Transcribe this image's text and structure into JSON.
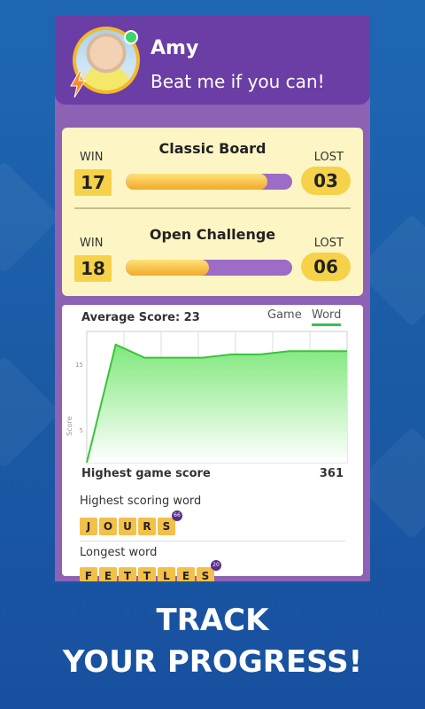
{
  "player": {
    "name": "Amy",
    "tagline": "Beat me if you can!"
  },
  "stats": [
    {
      "mode": "Classic Board",
      "win_label": "WIN",
      "win": "17",
      "lost_label": "LOST",
      "lost": "03",
      "win_fraction": 0.85
    },
    {
      "mode": "Open Challenge",
      "win_label": "WIN",
      "win": "18",
      "lost_label": "LOST",
      "lost": "06",
      "win_fraction": 0.5
    }
  ],
  "score_card": {
    "average_label": "Average Score: 23",
    "tabs": {
      "game": "Game",
      "word": "Word",
      "active": "Word"
    },
    "y_axis_label": "Score",
    "highest_game_label": "Highest game score",
    "highest_game_value": "361",
    "highest_word_label": "Highest scoring word",
    "highest_word_letters": [
      "J",
      "O",
      "U",
      "R",
      "S"
    ],
    "highest_word_score": "66",
    "longest_word_label": "Longest word",
    "longest_word_letters": [
      "F",
      "E",
      "T",
      "T",
      "L",
      "E",
      "S"
    ],
    "longest_word_score": "20"
  },
  "chart_data": {
    "type": "area",
    "y_ticks": [
      "15",
      "5"
    ],
    "ylim": [
      0,
      20
    ],
    "values": [
      0,
      18,
      16,
      16,
      16,
      16.5,
      16.5,
      17,
      17,
      17
    ],
    "grid": true,
    "fill_color": "#8ef08a",
    "line_color": "#38c43a"
  },
  "promo": {
    "line1": "TRACK",
    "line2": "YOUR PROGRESS!"
  },
  "colors": {
    "background": "#1a5aa5",
    "header": "#6b3ea5",
    "panel": "#8d61b3",
    "stats_card": "#fdf6c4",
    "tile": "#f3c04a",
    "accent_green": "#37c34d"
  }
}
